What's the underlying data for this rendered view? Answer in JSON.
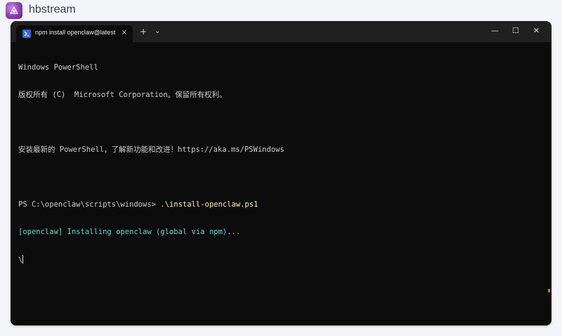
{
  "app": {
    "name": "hbstream",
    "logo_icon": "hbstream-logo-icon"
  },
  "terminal_window": {
    "tab": {
      "icon": "powershell-icon",
      "label": "npm install openclaw@latest",
      "close_symbol": "×"
    },
    "new_tab_symbol": "+",
    "dropdown_symbol": "⌄",
    "controls": {
      "minimize": "—",
      "maximize": "☐",
      "close": "✕"
    },
    "lines": [
      {
        "text": "Windows PowerShell",
        "kind": "plain"
      },
      {
        "text": "版权所有 (C)  Microsoft Corporation。保留所有权利。",
        "kind": "plain"
      },
      {
        "text": "",
        "kind": "plain"
      },
      {
        "text": "安装最新的 PowerShell，了解新功能和改进！https://aka.ms/PSWindows",
        "kind": "plain"
      },
      {
        "text": "",
        "kind": "plain"
      },
      {
        "prompt": "PS C:\\openclaw\\scripts\\windows> ",
        "command": ".\\install-openclaw.ps1",
        "kind": "prompt"
      },
      {
        "text": "[openclaw] Installing openclaw (global via npm)...",
        "kind": "info"
      },
      {
        "text": "\\",
        "kind": "cursor"
      }
    ],
    "colors": {
      "background": "#0c0c0c",
      "titlebar": "#202020",
      "text": "#cccccc",
      "command": "#f9f1a5",
      "info": "#61d6d6"
    }
  }
}
